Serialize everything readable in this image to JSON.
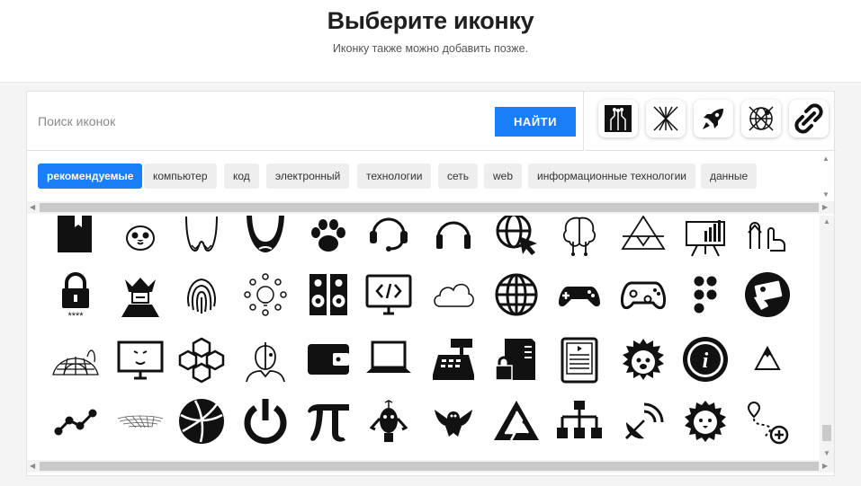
{
  "header": {
    "title": "Выберите иконку",
    "subtitle": "Иконку также можно добавить позже."
  },
  "search": {
    "placeholder": "Поиск иконок",
    "button_label": "НАЙТИ"
  },
  "selected_icons": [
    "circuit-chip-icon",
    "satellite-lines-icon",
    "rocket-icon",
    "globe-target-icon",
    "chain-link-icon"
  ],
  "tags": [
    {
      "label": "рекомендуемые",
      "active": true
    },
    {
      "label": "компьютер",
      "active": false
    },
    {
      "label": "код",
      "active": false
    },
    {
      "label": "электронный",
      "active": false
    },
    {
      "label": "технологии",
      "active": false
    },
    {
      "label": "сеть",
      "active": false
    },
    {
      "label": "web",
      "active": false
    },
    {
      "label": "информационные технологии",
      "active": false
    },
    {
      "label": "данные",
      "active": false
    }
  ],
  "icon_rows": [
    [
      "book-icon",
      "cat-face-icon",
      "tooth-icon",
      "beard-icon",
      "paw-icon",
      "headset-icon",
      "headphones-icon",
      "web-cursor-icon",
      "brain-circuit-icon",
      "triangle-glyph-icon",
      "presentation-chart-icon",
      "touch-gesture-icon"
    ],
    [
      "password-lock-icon",
      "samurai-icon",
      "fingerprint-icon",
      "idea-network-icon",
      "speakers-icon",
      "code-monitor-icon",
      "cloud-icon",
      "globe-icon",
      "gamepad-icon",
      "xbox-controller-icon",
      "braille-icon",
      "id-card-hand-icon"
    ],
    [
      "wireframe-dome-icon",
      "mask-monitor-icon",
      "cubes-network-icon",
      "cyborg-icon",
      "wallet-icon",
      "laptop-icon",
      "cash-register-icon",
      "server-lock-icon",
      "ebook-reader-icon",
      "hedgehog-icon",
      "info-icon",
      "mountain-icon"
    ],
    [
      "line-chart-icon",
      "wave-mesh-icon",
      "sphere-icon",
      "power-icon",
      "pi-icon",
      "robot-icon",
      "eagle-icon",
      "penrose-triangle-icon",
      "hierarchy-icon",
      "satellite-dish-icon",
      "lion-icon",
      "route-plus-icon"
    ]
  ]
}
